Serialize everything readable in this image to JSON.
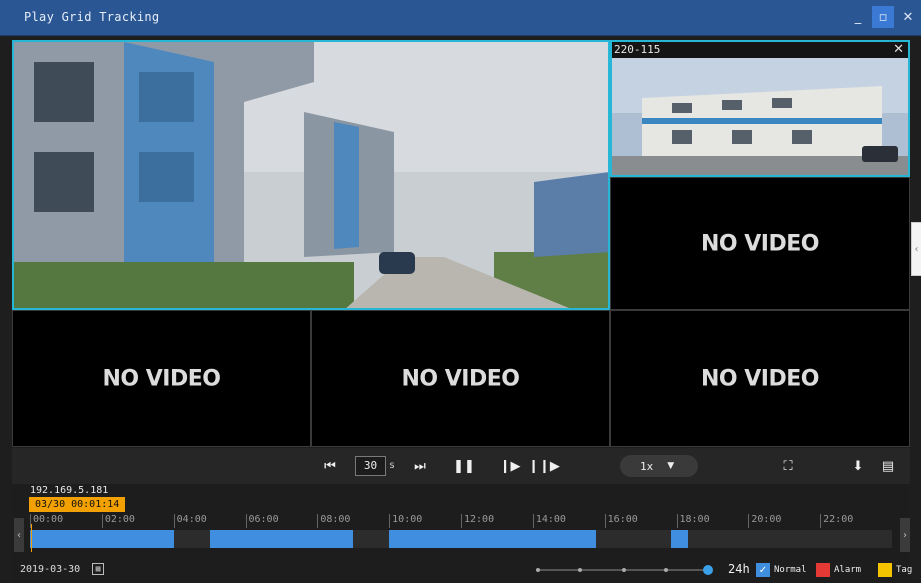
{
  "window": {
    "title": "Play Grid Tracking",
    "min_icon": "minimize-icon",
    "max_icon": "maximize-icon",
    "close_icon": "close-icon"
  },
  "grid": {
    "no_video_text": "NO VIDEO",
    "small_camera": {
      "name": "220-115"
    }
  },
  "controls": {
    "interval_value": "30",
    "interval_unit": "s",
    "speed": "1x"
  },
  "timeline": {
    "device_ip": "192.169.5.181",
    "current_time": "03/30 00:01:14",
    "ticks": [
      "00:00",
      "02:00",
      "04:00",
      "06:00",
      "08:00",
      "10:00",
      "12:00",
      "14:00",
      "16:00",
      "18:00",
      "20:00",
      "22:00"
    ],
    "segments": [
      {
        "start": "00:00",
        "end": "04:00",
        "type": "Normal"
      },
      {
        "start": "05:00",
        "end": "09:00",
        "type": "Normal"
      },
      {
        "start": "10:00",
        "end": "15:45",
        "type": "Normal"
      },
      {
        "start": "17:50",
        "end": "18:20",
        "type": "Normal"
      }
    ],
    "cursor_time": "00:01:14"
  },
  "status": {
    "date": "2019-03-30",
    "zoom_label": "24h",
    "legend": [
      {
        "label": "Normal",
        "color": "#3f8ee0"
      },
      {
        "label": "Alarm",
        "color": "#e53935"
      },
      {
        "label": "Tag",
        "color": "#f5c400"
      }
    ]
  },
  "colors": {
    "accent": "#27b7d6",
    "titlebar": "#2b5694",
    "timestamp": "#f2a100"
  }
}
